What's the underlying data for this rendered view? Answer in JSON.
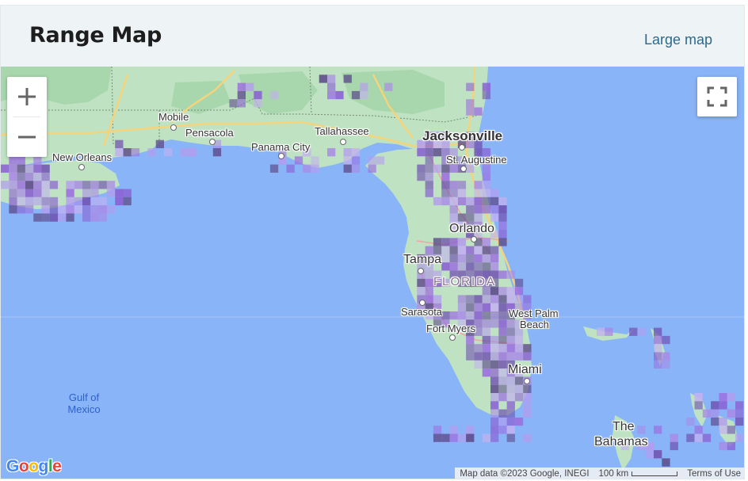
{
  "header": {
    "title": "Range Map",
    "large_map_link": "Large map"
  },
  "map": {
    "controls": {
      "zoom_in_icon": "plus-icon",
      "zoom_out_icon": "minus-icon",
      "fullscreen_icon": "fullscreen-icon"
    },
    "labels": {
      "mobile": "Mobile",
      "pensacola": "Pensacola",
      "new_orleans": "New Orleans",
      "panama_city": "Panama City",
      "tallahassee": "Tallahassee",
      "jacksonville": "Jacksonville",
      "st_augustine": "St. Augustine",
      "orlando": "Orlando",
      "tampa": "Tampa",
      "florida": "FLORIDA",
      "sarasota": "Sarasota",
      "fort_myers": "Fort Myers",
      "west_palm": "West Palm",
      "beach": "Beach",
      "miami": "Miami",
      "the": "The",
      "bahamas": "Bahamas",
      "gulf_of": "Gulf of",
      "mexico": "Mexico"
    },
    "logo": "Google",
    "attribution": {
      "map_data": "Map data ©2023 Google, INEGI",
      "scale": "100 km",
      "terms": "Terms of Use"
    },
    "colors": {
      "water": "#8ab4f8",
      "land": "#c8e6c9",
      "range": "#9b6fe0"
    }
  }
}
